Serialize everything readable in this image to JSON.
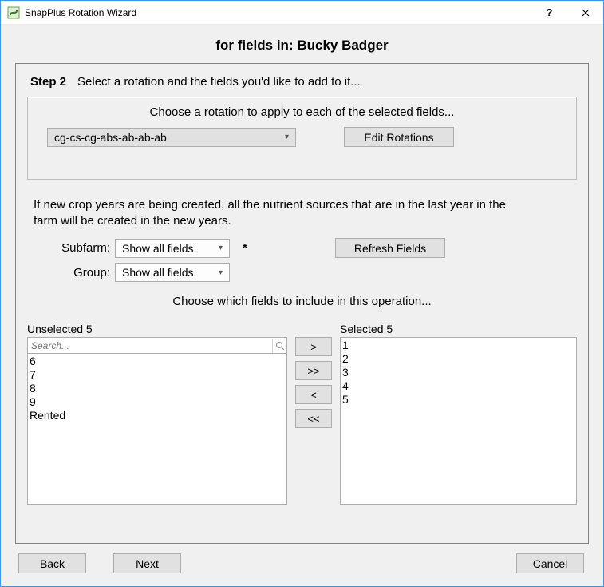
{
  "window": {
    "title": "SnapPlus Rotation Wizard",
    "help": "?",
    "close": "✕"
  },
  "header": {
    "page_title": "for fields in: Bucky Badger"
  },
  "step": {
    "label": "Step 2",
    "text": "Select a rotation and the fields you'd like to add to it..."
  },
  "rotation_group": {
    "label": "Choose a rotation to apply to each of the selected fields...",
    "selected": "cg-cs-cg-abs-ab-ab-ab",
    "edit_button": "Edit Rotations"
  },
  "info_text": "If new crop years are being created, all the nutrient sources that are in the last year in the farm will be created in the new years.",
  "filters": {
    "subfarm_label": "Subfarm:",
    "subfarm_value": "Show all fields.",
    "group_label": "Group:",
    "group_value": "Show all fields.",
    "asterisk": "*",
    "refresh_button": "Refresh Fields"
  },
  "choose_text": "Choose which fields to include in this operation...",
  "lists": {
    "unselected_label": "Unselected 5",
    "selected_label": "Selected 5",
    "search_placeholder": "Search...",
    "unselected": [
      "6",
      "7",
      "8",
      "9",
      "Rented"
    ],
    "selected": [
      "1",
      "2",
      "3",
      "4",
      "5"
    ]
  },
  "movers": {
    "add": ">",
    "add_all": ">>",
    "remove": "<",
    "remove_all": "<<"
  },
  "footer": {
    "back": "Back",
    "next": "Next",
    "cancel": "Cancel"
  }
}
